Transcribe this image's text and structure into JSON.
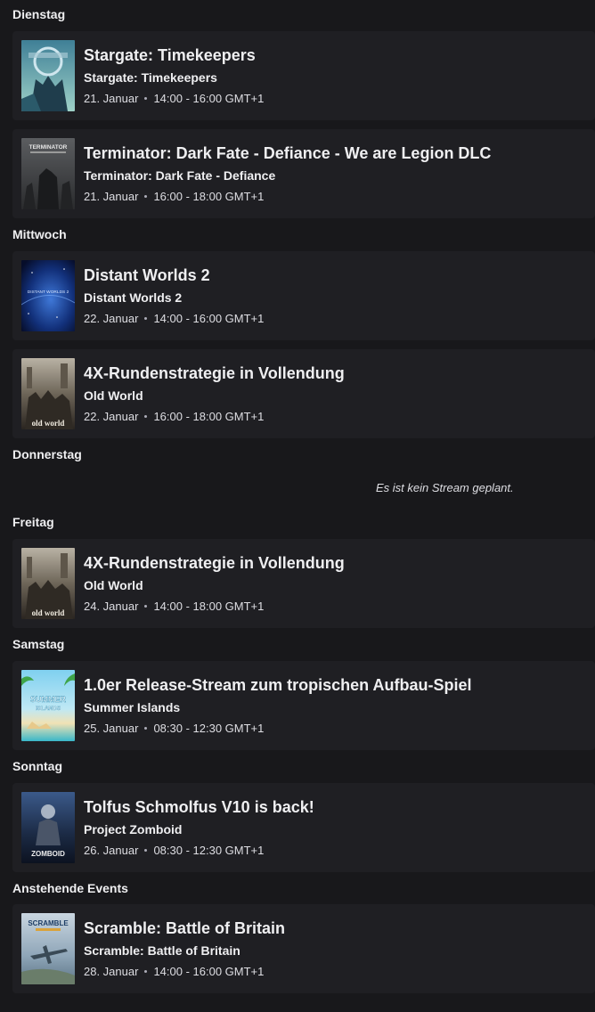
{
  "days": [
    {
      "label": "Dienstag"
    },
    {
      "label": "Mittwoch"
    },
    {
      "label": "Donnerstag",
      "empty_text": "Es ist kein Stream geplant."
    },
    {
      "label": "Freitag"
    },
    {
      "label": "Samstag"
    },
    {
      "label": "Sonntag"
    },
    {
      "label": "Anstehende Events"
    }
  ],
  "events": [
    {
      "title": "Stargate: Timekeepers",
      "game": "Stargate: Timekeepers",
      "date": "21. Januar",
      "time": "14:00 - 16:00 GMT+1",
      "thumb_icon": "stargate-cover-art"
    },
    {
      "title": "Terminator: Dark Fate - Defiance - We are Legion DLC",
      "game": "Terminator: Dark Fate - Defiance",
      "date": "21. Januar",
      "time": "16:00 - 18:00 GMT+1",
      "thumb_icon": "terminator-cover-art"
    },
    {
      "title": "Distant Worlds 2",
      "game": "Distant Worlds 2",
      "date": "22. Januar",
      "time": "14:00 - 16:00 GMT+1",
      "thumb_icon": "distant-worlds-cover-art"
    },
    {
      "title": "4X-Rundenstrategie in Vollendung",
      "game": "Old World",
      "date": "22. Januar",
      "time": "16:00 - 18:00 GMT+1",
      "thumb_icon": "old-world-cover-art"
    },
    {
      "title": "4X-Rundenstrategie in Vollendung",
      "game": "Old World",
      "date": "24. Januar",
      "time": "14:00 - 18:00 GMT+1",
      "thumb_icon": "old-world-cover-art"
    },
    {
      "title": "1.0er Release-Stream zum tropischen Aufbau-Spiel",
      "game": "Summer Islands",
      "date": "25. Januar",
      "time": "08:30 - 12:30 GMT+1",
      "thumb_icon": "summer-islands-cover-art"
    },
    {
      "title": "Tolfus Schmolfus V10 is back!",
      "game": "Project Zomboid",
      "date": "26. Januar",
      "time": "08:30 - 12:30 GMT+1",
      "thumb_icon": "project-zomboid-cover-art"
    },
    {
      "title": "Scramble: Battle of Britain",
      "game": "Scramble: Battle of Britain",
      "date": "28. Januar",
      "time": "14:00 - 16:00 GMT+1",
      "thumb_icon": "scramble-cover-art"
    }
  ],
  "thumb_text": {
    "terminator": "TERMINATOR",
    "distant": "DISTANT WORLDS 2",
    "oldworld": "old world",
    "summer1": "SUMMER",
    "summer2": "ISLANDS",
    "zomboid": "ZOMBOID",
    "scramble": "SCRAMBLE"
  },
  "colors": {
    "background": "#18181b",
    "card": "#1f1f23",
    "text": "#efeff1",
    "muted": "#adadb8"
  }
}
